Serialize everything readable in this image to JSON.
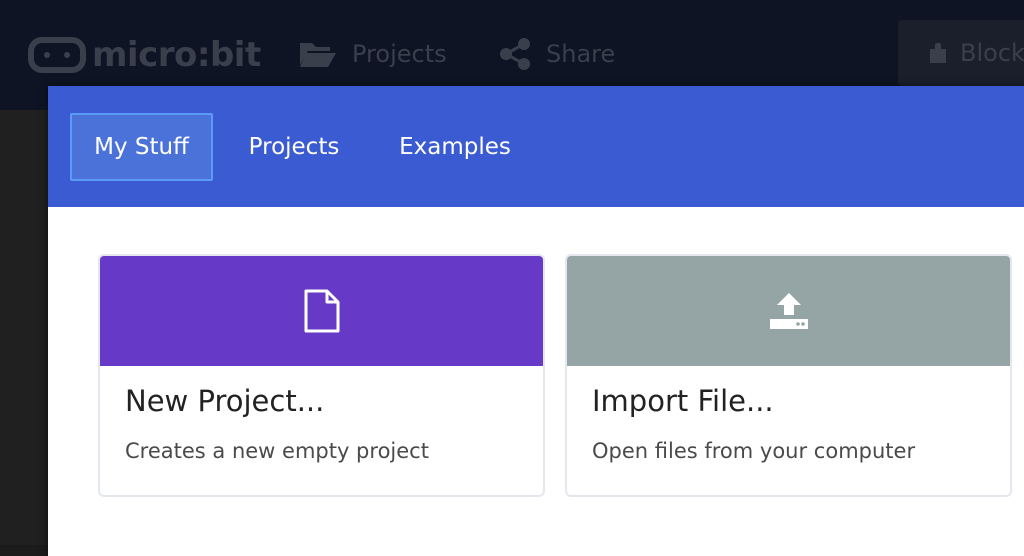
{
  "app": {
    "brand": "micro:bit",
    "menu": [
      {
        "label": "Projects",
        "icon": "folder-open-icon"
      },
      {
        "label": "Share",
        "icon": "share-icon"
      }
    ],
    "blocks_label": "Block"
  },
  "modal": {
    "tabs": [
      {
        "label": "My Stuff",
        "active": true
      },
      {
        "label": "Projects",
        "active": false
      },
      {
        "label": "Examples",
        "active": false
      }
    ],
    "cards": [
      {
        "title": "New Project...",
        "description": "Creates a new empty project",
        "icon": "file-icon",
        "color": "#6639c6"
      },
      {
        "title": "Import File...",
        "description": "Open files from your computer",
        "icon": "upload-icon",
        "color": "#95a5a6"
      }
    ]
  },
  "colors": {
    "header": "#3b5bd2",
    "topbar": "#0e1424",
    "tab_active_border": "#5b9bf5"
  }
}
